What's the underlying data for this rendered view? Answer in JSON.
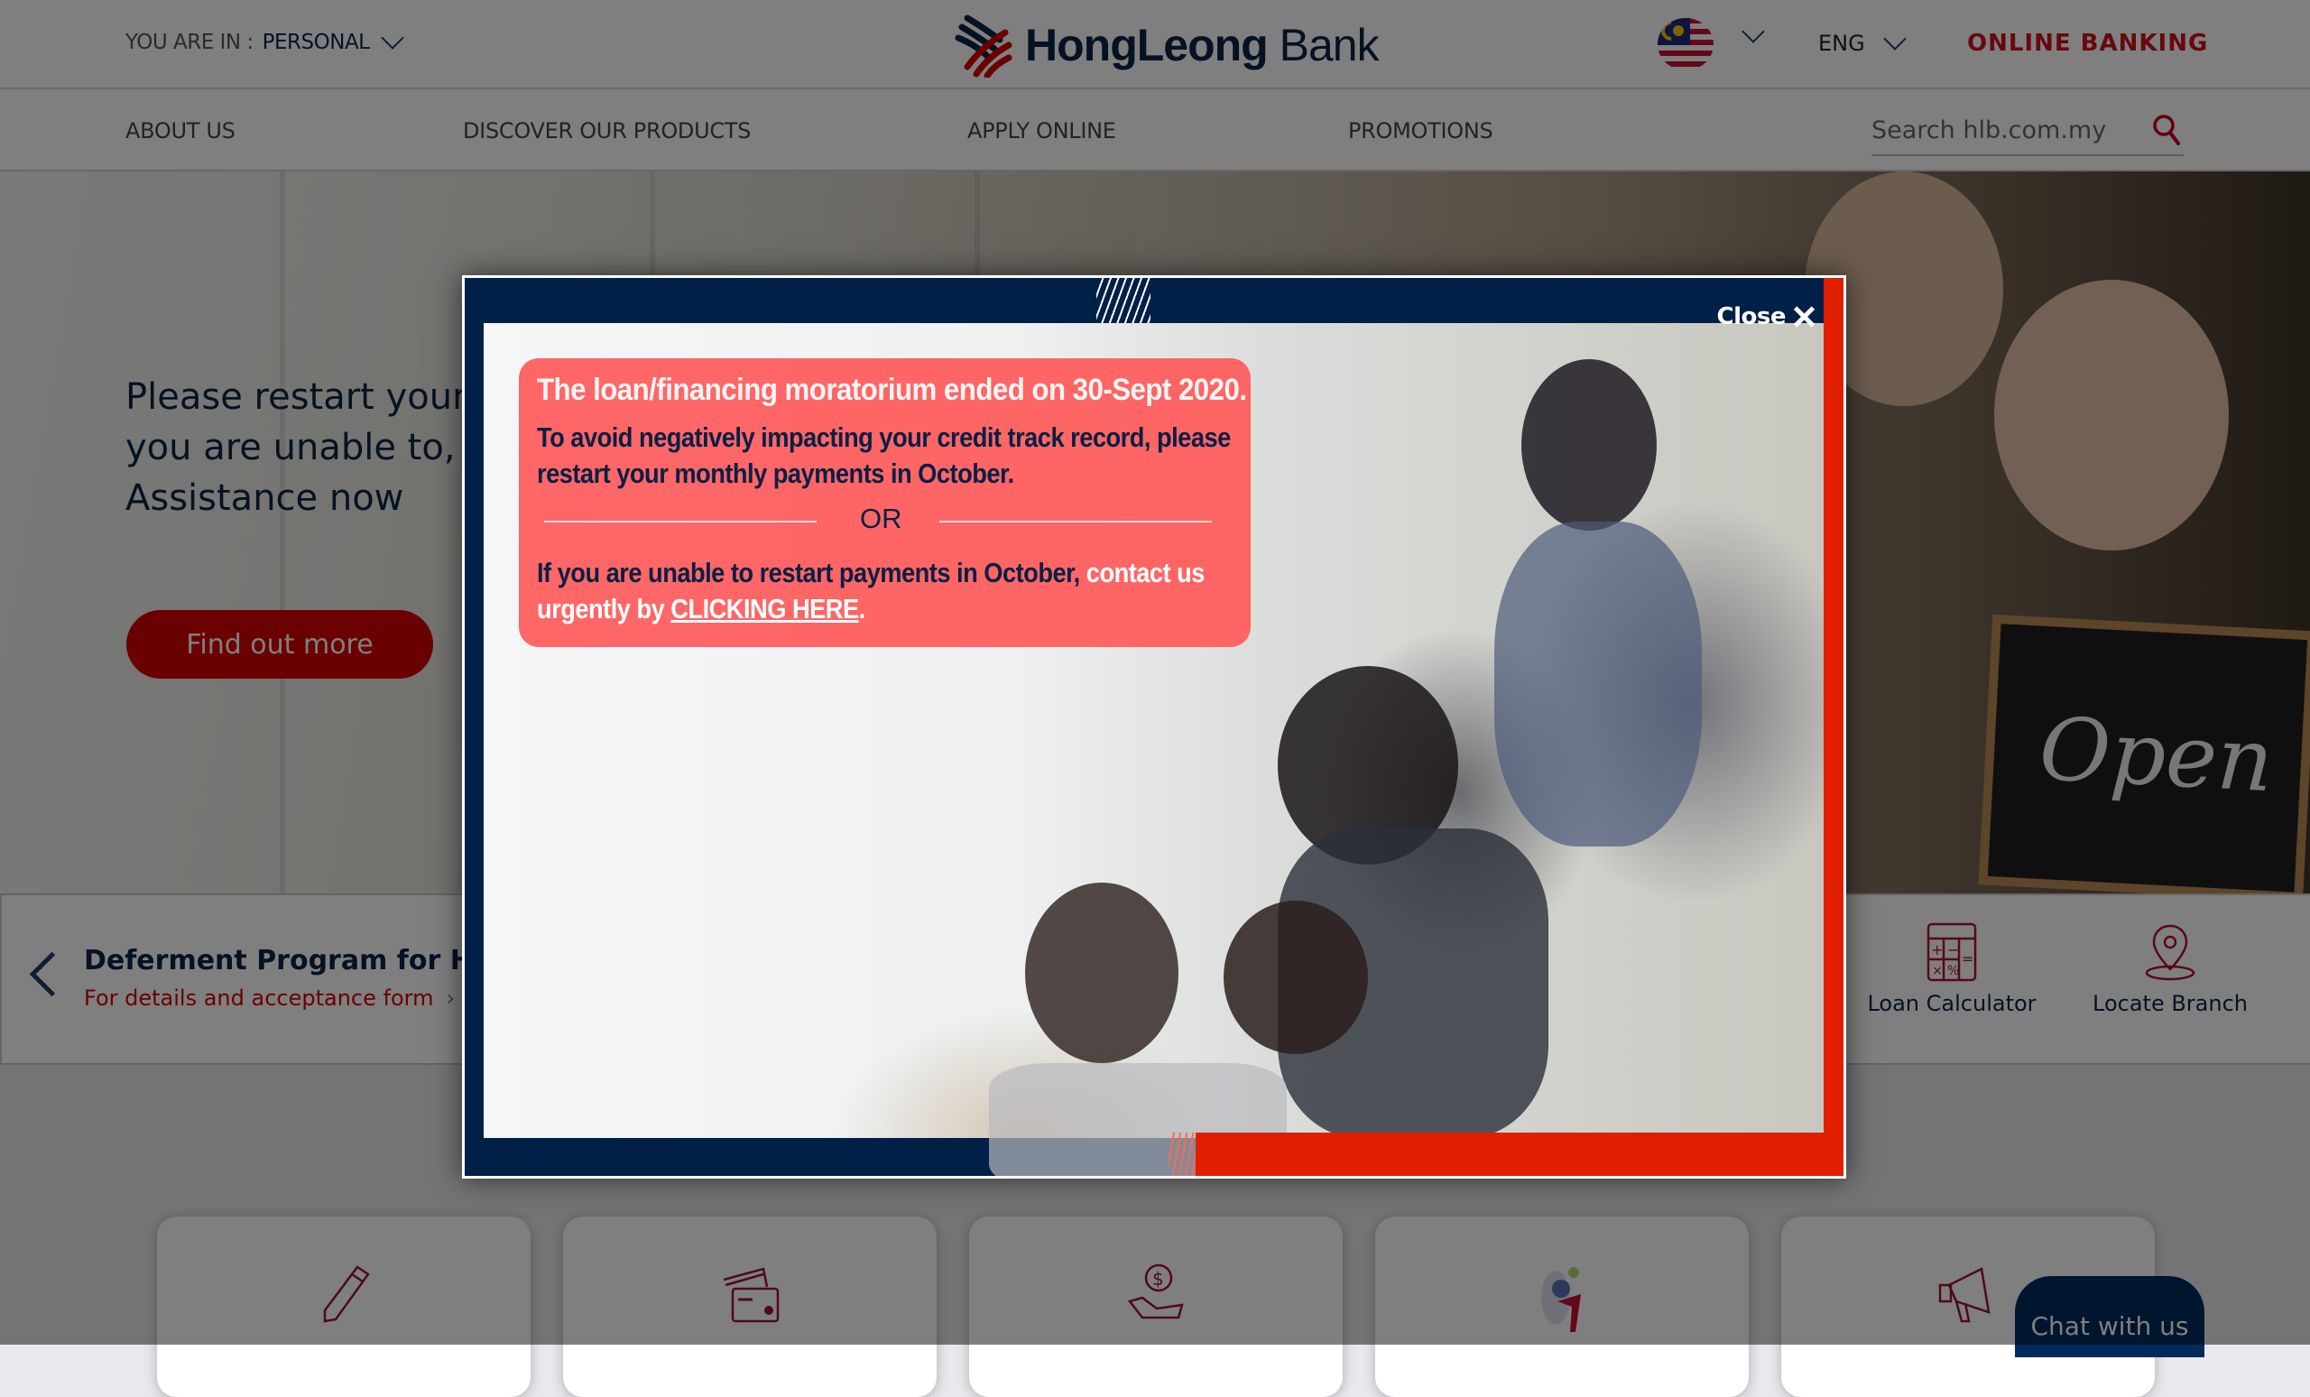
{
  "header": {
    "you_are_in_label": "YOU ARE IN :",
    "segment": "PERSONAL",
    "logo_bold": "HongLeong",
    "logo_light": "Bank",
    "country_flag": "malaysia-flag-icon",
    "language": "ENG",
    "online_banking": "ONLINE BANKING"
  },
  "nav": {
    "items": [
      {
        "label": "ABOUT US"
      },
      {
        "label": "DISCOVER OUR PRODUCTS"
      },
      {
        "label": "APPLY ONLINE"
      },
      {
        "label": "PROMOTIONS"
      }
    ],
    "search_placeholder": "Search hlb.com.my"
  },
  "hero": {
    "title": "Please restart your monthly payments OR IF you are unable to, apply for Payment Assistance now",
    "cta": "Find out more",
    "chalkboard_text": "Open"
  },
  "strip": {
    "title": "Deferment Program for Hire Purchase",
    "subtitle": "For details and acceptance form",
    "tools": [
      {
        "label": "Loan Calculator",
        "icon": "calculator-icon"
      },
      {
        "label": "Locate Branch",
        "icon": "location-pin-icon"
      }
    ]
  },
  "cards": [
    {
      "icon": "pencil-icon"
    },
    {
      "icon": "credit-card-icon"
    },
    {
      "icon": "money-hand-icon"
    },
    {
      "icon": "person-illustration-icon"
    },
    {
      "icon": "megaphone-icon"
    }
  ],
  "chat": {
    "label": "Chat with us"
  },
  "modal": {
    "close_label": "Close",
    "headline": "The loan/financing moratorium ended on 30-Sept 2020.",
    "body1": "To avoid negatively impacting your credit track record, please restart your monthly payments in October.",
    "or": "OR",
    "body2_dark": "If you are unable to restart payments in October,",
    "body2_light": "contact us urgently by",
    "body2_link": "CLICKING HERE",
    "body2_end": ".",
    "colors": {
      "navy": "#002048",
      "red": "#e01e00",
      "notice": "#ff5a5a"
    }
  }
}
